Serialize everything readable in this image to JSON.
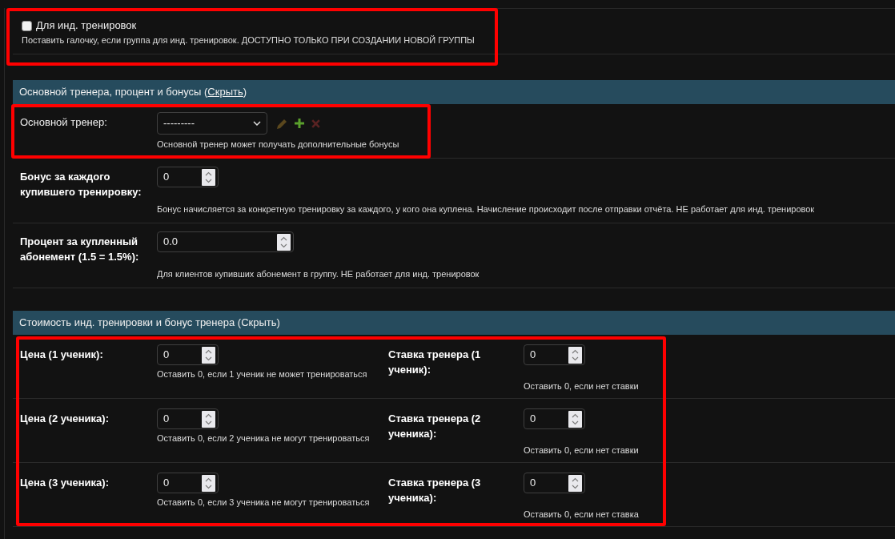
{
  "individual": {
    "label": "Для инд. тренировок",
    "checked": false,
    "help": "Поставить галочку, если группа для инд. тренировок. ДОСТУПНО ТОЛЬКО ПРИ СОЗДАНИИ НОВОЙ ГРУППЫ",
    "highlighted": true
  },
  "sections": [
    {
      "kind": "fields",
      "heading": {
        "text": "Основной тренера, процент и бонусы (",
        "link": "Скрыть",
        "text_after": ")",
        "link_hovered": true
      },
      "fields": [
        {
          "kind": "select",
          "label": "Основной тренер:",
          "required": false,
          "value": "---------",
          "actions": [
            {
              "kind": "edit",
              "disabled": true
            },
            {
              "kind": "add",
              "disabled": false
            },
            {
              "kind": "delete",
              "disabled": true
            }
          ],
          "help": "Основной тренер может получать дополнительные бонусы",
          "highlighted": true
        },
        {
          "kind": "number",
          "label": "Бонус за каждого купившего тренировку:",
          "required": true,
          "value": "0",
          "help": "Бонус начисляется за конкретную тренировку за каждого, у кого она куплена. Начисление происходит после отправки отчёта. НЕ работает для инд. тренировок",
          "highlighted": false
        },
        {
          "kind": "decimal",
          "label": "Процент за купленный абонемент (1.5 = 1.5%):",
          "required": true,
          "value": "0.0",
          "help": "Для клиентов купивших абонемент в группу. НЕ работает для инд. тренировок",
          "highlighted": false
        }
      ]
    },
    {
      "kind": "pairs",
      "heading": {
        "text": "Стоимость инд. тренировки и бонус тренера (",
        "link": "Скрыть",
        "text_after": ")",
        "link_hovered": false
      },
      "highlighted": true,
      "rows": [
        {
          "left": {
            "label": "Цена (1 ученик):",
            "required": true,
            "value": "0",
            "help": "Оставить 0, если 1 ученик не может тренироваться"
          },
          "right": {
            "label": "Ставка тренера (1 ученик):",
            "required": true,
            "value": "0",
            "help": "Оставить 0, если нет ставки"
          }
        },
        {
          "left": {
            "label": "Цена (2 ученика):",
            "required": true,
            "value": "0",
            "help": "Оставить 0, если 2 ученика не могут тренироваться"
          },
          "right": {
            "label": "Ставка тренера (2 ученика):",
            "required": true,
            "value": "0",
            "help": "Оставить 0, если нет ставки"
          }
        },
        {
          "left": {
            "label": "Цена (3 ученика):",
            "required": true,
            "value": "0",
            "help": "Оставить 0, если 3 ученика не могут тренироваться"
          },
          "right": {
            "label": "Ставка тренера (3 ученика):",
            "required": true,
            "value": "0",
            "help": "Оставить 0, если нет ставка"
          }
        }
      ]
    }
  ]
}
